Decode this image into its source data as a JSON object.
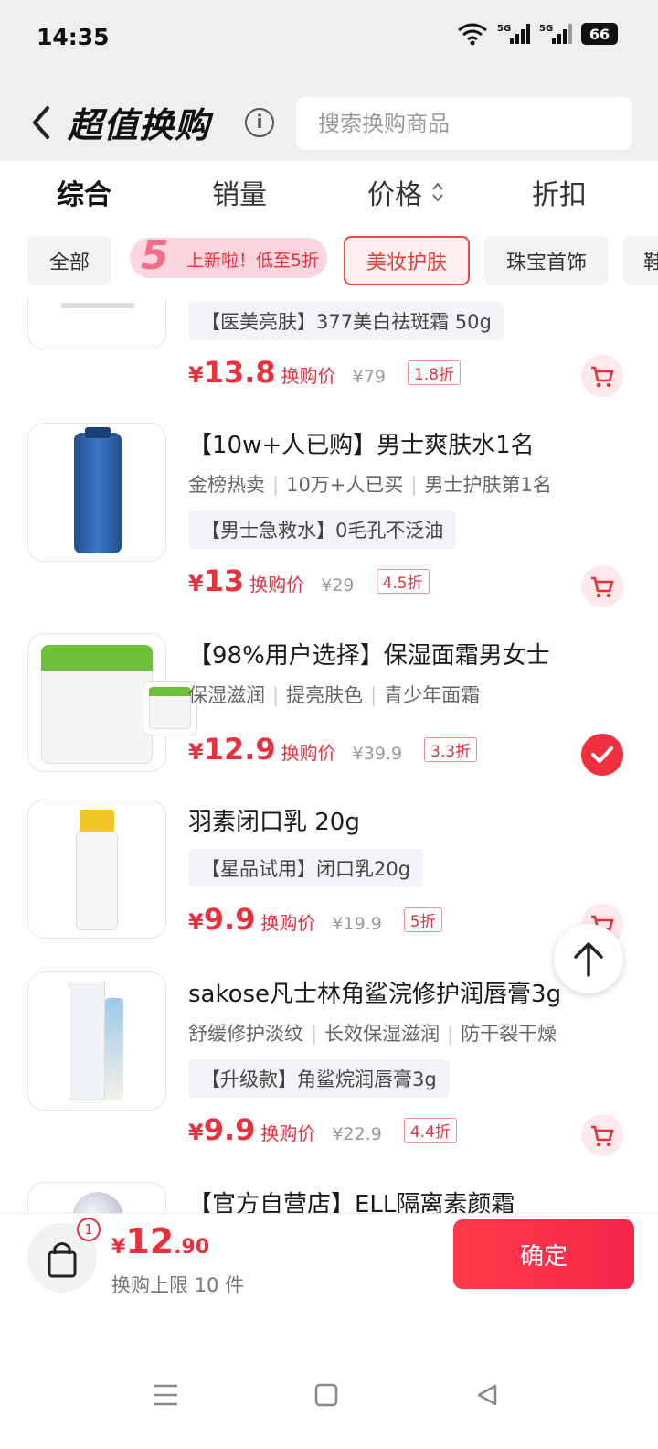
{
  "status_bar": {
    "time": "14:35",
    "battery": "66"
  },
  "header": {
    "title": "超值换购",
    "search_placeholder": "搜索换购商品"
  },
  "sort_tabs": [
    {
      "label": "综合"
    },
    {
      "label": "销量"
    },
    {
      "label": "价格"
    },
    {
      "label": "折扣"
    }
  ],
  "chips": {
    "all": "全部",
    "promo_number": "5",
    "promo_text": "上新啦！低至5折",
    "beauty": "美妆护肤",
    "jewelry": "珠宝首饰",
    "partial": "鞋"
  },
  "items": [
    {
      "badge": "【医美亮肤】377美白祛斑霜 50g",
      "price": "13.8",
      "price_label": "换购价",
      "orig": "¥79",
      "discount": "1.8折",
      "selected": false
    },
    {
      "name": "【10w+人已购】男士爽肤水1名",
      "tags": [
        "金榜热卖",
        "10万+人已买",
        "男士护肤第1名"
      ],
      "badge": "【男士急救水】0毛孔不泛油",
      "price": "13",
      "price_label": "换购价",
      "orig": "¥29",
      "discount": "4.5折",
      "selected": false
    },
    {
      "name": "【98%用户选择】保湿面霜男女士",
      "tags": [
        "保湿滋润",
        "提亮肤色",
        "青少年面霜"
      ],
      "price": "12.9",
      "price_label": "换购价",
      "orig": "¥39.9",
      "discount": "3.3折",
      "selected": true
    },
    {
      "name": "羽素闭口乳 20g",
      "badge": "【星品试用】闭口乳20g",
      "price": "9.9",
      "price_label": "换购价",
      "orig": "¥19.9",
      "discount": "5折",
      "selected": false
    },
    {
      "name": "sakose凡士林角鲨浣修护润唇膏3g",
      "tags": [
        "舒缓修护淡纹",
        "长效保湿滋润",
        "防干裂干燥"
      ],
      "badge": "【升级款】角鲨烷润唇膏3g",
      "price": "9.9",
      "price_label": "换购价",
      "orig": "¥22.9",
      "discount": "4.4折",
      "selected": false
    },
    {
      "name": "【官方自营店】ELL隔离素颜霜"
    }
  ],
  "footer": {
    "cart_count": "1",
    "currency": "¥",
    "total_int": "12",
    "total_dec": ".90",
    "limit": "换购上限 10 件",
    "confirm": "确定"
  },
  "colors": {
    "accent": "#e8313f",
    "promo_bg": "#fbd6dd",
    "page_bg": "#efefef"
  },
  "icons": {
    "back": "chevron-left-icon",
    "info": "info-icon",
    "cart": "cart-icon",
    "check": "check-icon",
    "to_top": "arrow-up-icon",
    "bag": "shopping-bag-icon",
    "nav": [
      "menu-icon",
      "home-icon",
      "back-triangle-icon"
    ]
  }
}
